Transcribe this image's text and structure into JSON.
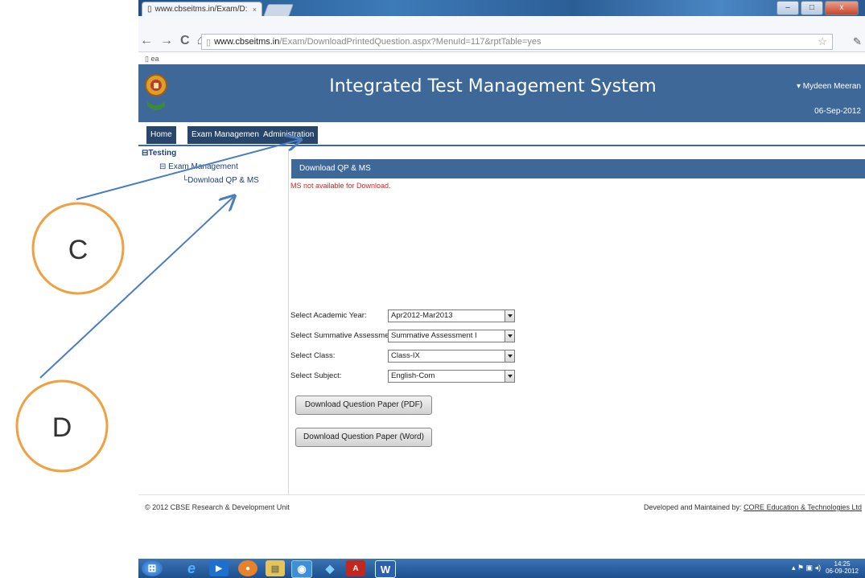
{
  "browser": {
    "tab_title": "www.cbseitms.in/Exam/D:",
    "tab_close": "×",
    "window_controls": [
      "–",
      "□",
      "x"
    ],
    "url_host": "www.cbseitms.in",
    "url_path": "/Exam/DownloadPrintedQuestion.aspx?MenuId=117&rptTable=yes",
    "bookmark_label": "ea",
    "nav_back": "←",
    "nav_forward": "→",
    "nav_reload": "C",
    "nav_home": "⌂",
    "star_icon": "☆",
    "wrench_icon": "🔧"
  },
  "header": {
    "title": "Integrated Test Management System",
    "user": "▾ Mydeen Meeran",
    "date": "06-Sep-2012"
  },
  "menu": {
    "items": [
      "Home",
      "Exam Management",
      "Administration"
    ]
  },
  "tree": {
    "root": "⊟Testing",
    "group": "⊟ Exam Management",
    "leaf": "└Download QP & MS"
  },
  "panel": {
    "heading": "Download QP & MS",
    "error": "MS not available for Download."
  },
  "form": {
    "fields": [
      {
        "label": "Select Academic Year:",
        "value": "Apr2012-Mar2013"
      },
      {
        "label": "Select Summative Assessment:",
        "value": "Summative Assessment I"
      },
      {
        "label": "Select Class:",
        "value": "Class-IX"
      },
      {
        "label": "Select Subject:",
        "value": "English-Com"
      }
    ],
    "buttons": [
      "Download Question Paper (PDF)",
      "Download Question Paper (Word)"
    ]
  },
  "footer": {
    "copyright": "© 2012 CBSE Research & Development Unit",
    "developer_prefix": "Developed and Maintained by: ",
    "developer_link": "CORE Education & Technologies Ltd"
  },
  "taskbar": {
    "clock_time": "14:25",
    "clock_date": "06-09-2012",
    "tray": "▴ ⚑ ▣ ◂)"
  },
  "annotations": {
    "c_label": "C",
    "d_label": "D",
    "accent": "#f0a040",
    "arrow": "#4a7cc0"
  }
}
